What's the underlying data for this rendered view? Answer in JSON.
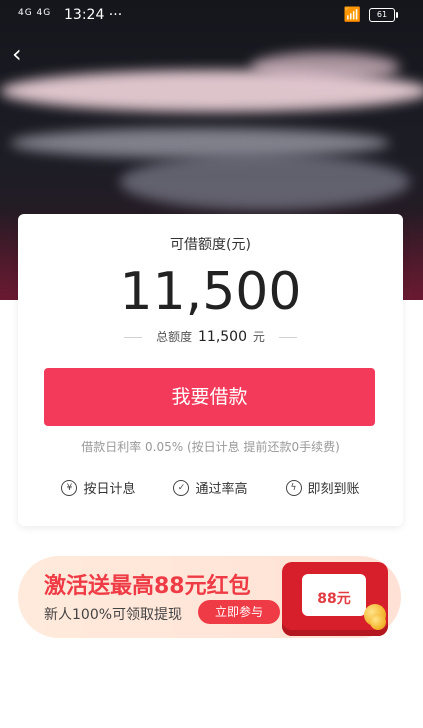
{
  "status_bar": {
    "signal": "4G 4G",
    "time": "13:24 ···",
    "battery": "61"
  },
  "card": {
    "label": "可借额度(元)",
    "amount": "11,500",
    "total_label": "总额度",
    "total_value": "11,500",
    "total_unit": "元",
    "borrow_button": "我要借款",
    "rate_text": "借款日利率 0.05% (按日计息 提前还款0手续费)",
    "features": [
      {
        "icon": "yen-icon",
        "label": "按日计息"
      },
      {
        "icon": "check-circle-icon",
        "label": "通过率高"
      },
      {
        "icon": "lightning-icon",
        "label": "即刻到账"
      }
    ]
  },
  "banner": {
    "title": "激活送最高88元红包",
    "subtitle": "新人100%可领取提现",
    "join_button": "立即参与",
    "badge_number": "88",
    "badge_unit": "元"
  },
  "colors": {
    "accent": "#f43a5a",
    "banner_red": "#ef3b45"
  }
}
